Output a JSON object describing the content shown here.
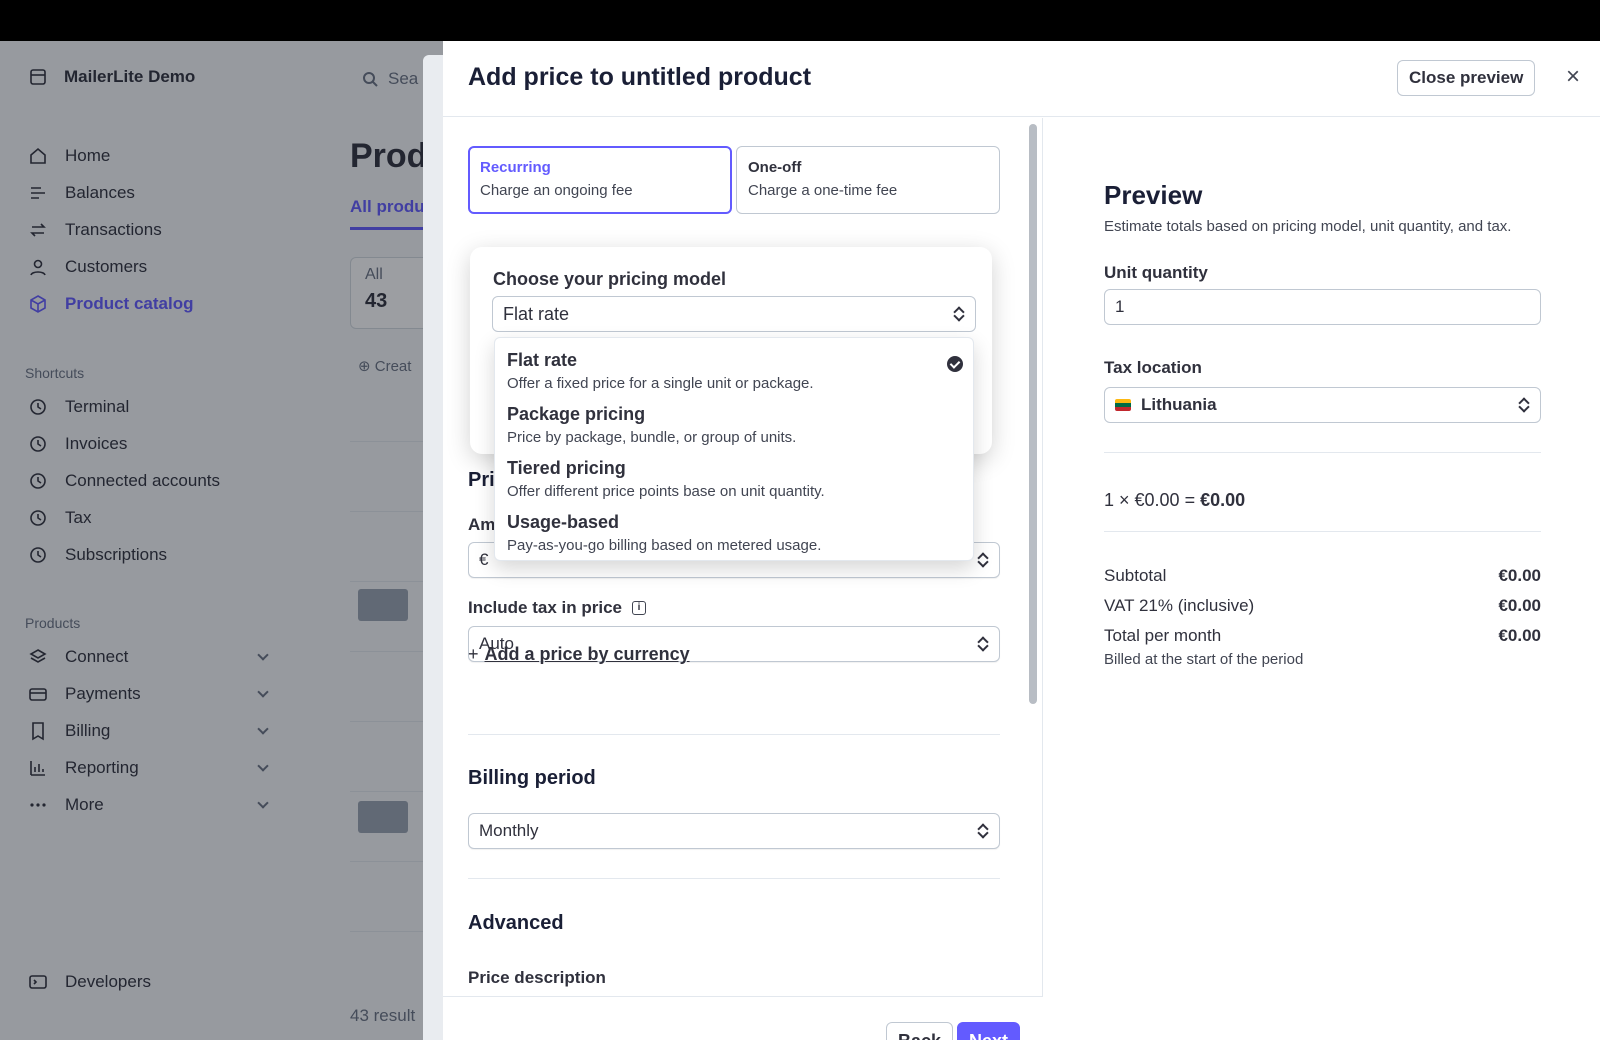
{
  "sidebar": {
    "brand": "MailerLite Demo",
    "items": [
      {
        "label": "Home",
        "icon": "home-icon"
      },
      {
        "label": "Balances",
        "icon": "balances-icon"
      },
      {
        "label": "Transactions",
        "icon": "transactions-icon"
      },
      {
        "label": "Customers",
        "icon": "customers-icon"
      },
      {
        "label": "Product catalog",
        "icon": "product-catalog-icon",
        "active": true
      }
    ],
    "shortcuts_label": "Shortcuts",
    "shortcuts": [
      {
        "label": "Terminal",
        "icon": "clock-icon"
      },
      {
        "label": "Invoices",
        "icon": "clock-icon"
      },
      {
        "label": "Connected accounts",
        "icon": "clock-icon"
      },
      {
        "label": "Tax",
        "icon": "clock-icon"
      },
      {
        "label": "Subscriptions",
        "icon": "clock-icon"
      }
    ],
    "products_label": "Products",
    "products": [
      {
        "label": "Connect",
        "icon": "connect-icon"
      },
      {
        "label": "Payments",
        "icon": "payments-icon"
      },
      {
        "label": "Billing",
        "icon": "billing-icon"
      },
      {
        "label": "Reporting",
        "icon": "reporting-icon"
      },
      {
        "label": "More",
        "icon": "more-icon"
      }
    ],
    "developers": "Developers"
  },
  "background": {
    "search": "Sea",
    "title": "Prod",
    "tab": "All produ",
    "card_label": "All",
    "card_count": "43",
    "create": "Creat",
    "results": "43 result"
  },
  "panel": {
    "title": "Add price to untitled product",
    "close_preview": "Close preview",
    "close_icon": "×",
    "price_types": [
      {
        "title": "Recurring",
        "desc": "Charge an ongoing fee",
        "selected": true
      },
      {
        "title": "One-off",
        "desc": "Charge a one-time fee",
        "selected": false
      }
    ],
    "price_section_partial": "Pri",
    "amount_label_partial": "Am",
    "currency_symbol": "€",
    "include_tax_label": "Include tax in price",
    "include_tax_value": "Auto",
    "add_currency_plus": "+",
    "add_currency": "Add a price by currency",
    "billing_period_title": "Billing period",
    "billing_period_value": "Monthly",
    "advanced_title": "Advanced",
    "advanced_partial": "Price description",
    "back": "Back",
    "next": "Next"
  },
  "pricing_model": {
    "title": "Choose your pricing model",
    "selected": "Flat rate",
    "options": [
      {
        "title": "Flat rate",
        "desc": "Offer a fixed price for a single unit or package.",
        "checked": true
      },
      {
        "title": "Package pricing",
        "desc": "Price by package, bundle, or group of units.",
        "checked": false
      },
      {
        "title": "Tiered pricing",
        "desc": "Offer different price points base on unit quantity.",
        "checked": false
      },
      {
        "title": "Usage-based",
        "desc": "Pay-as-you-go billing based on metered usage.",
        "checked": false
      }
    ]
  },
  "preview": {
    "title": "Preview",
    "desc": "Estimate totals based on pricing model, unit quantity, and tax.",
    "unit_quantity_label": "Unit quantity",
    "unit_quantity_value": "1",
    "tax_location_label": "Tax location",
    "tax_location_value": "Lithuania",
    "formula_left": "1 × €0.00 =",
    "formula_result": "€0.00",
    "subtotal_label": "Subtotal",
    "subtotal_value": "€0.00",
    "vat_label": "VAT 21% (inclusive)",
    "vat_value": "€0.00",
    "total_label": "Total per month",
    "total_value": "€0.00",
    "billed_note": "Billed at the start of the period"
  },
  "colors": {
    "accent": "#635bff",
    "text": "#30313d",
    "border": "#c0c8d2"
  }
}
